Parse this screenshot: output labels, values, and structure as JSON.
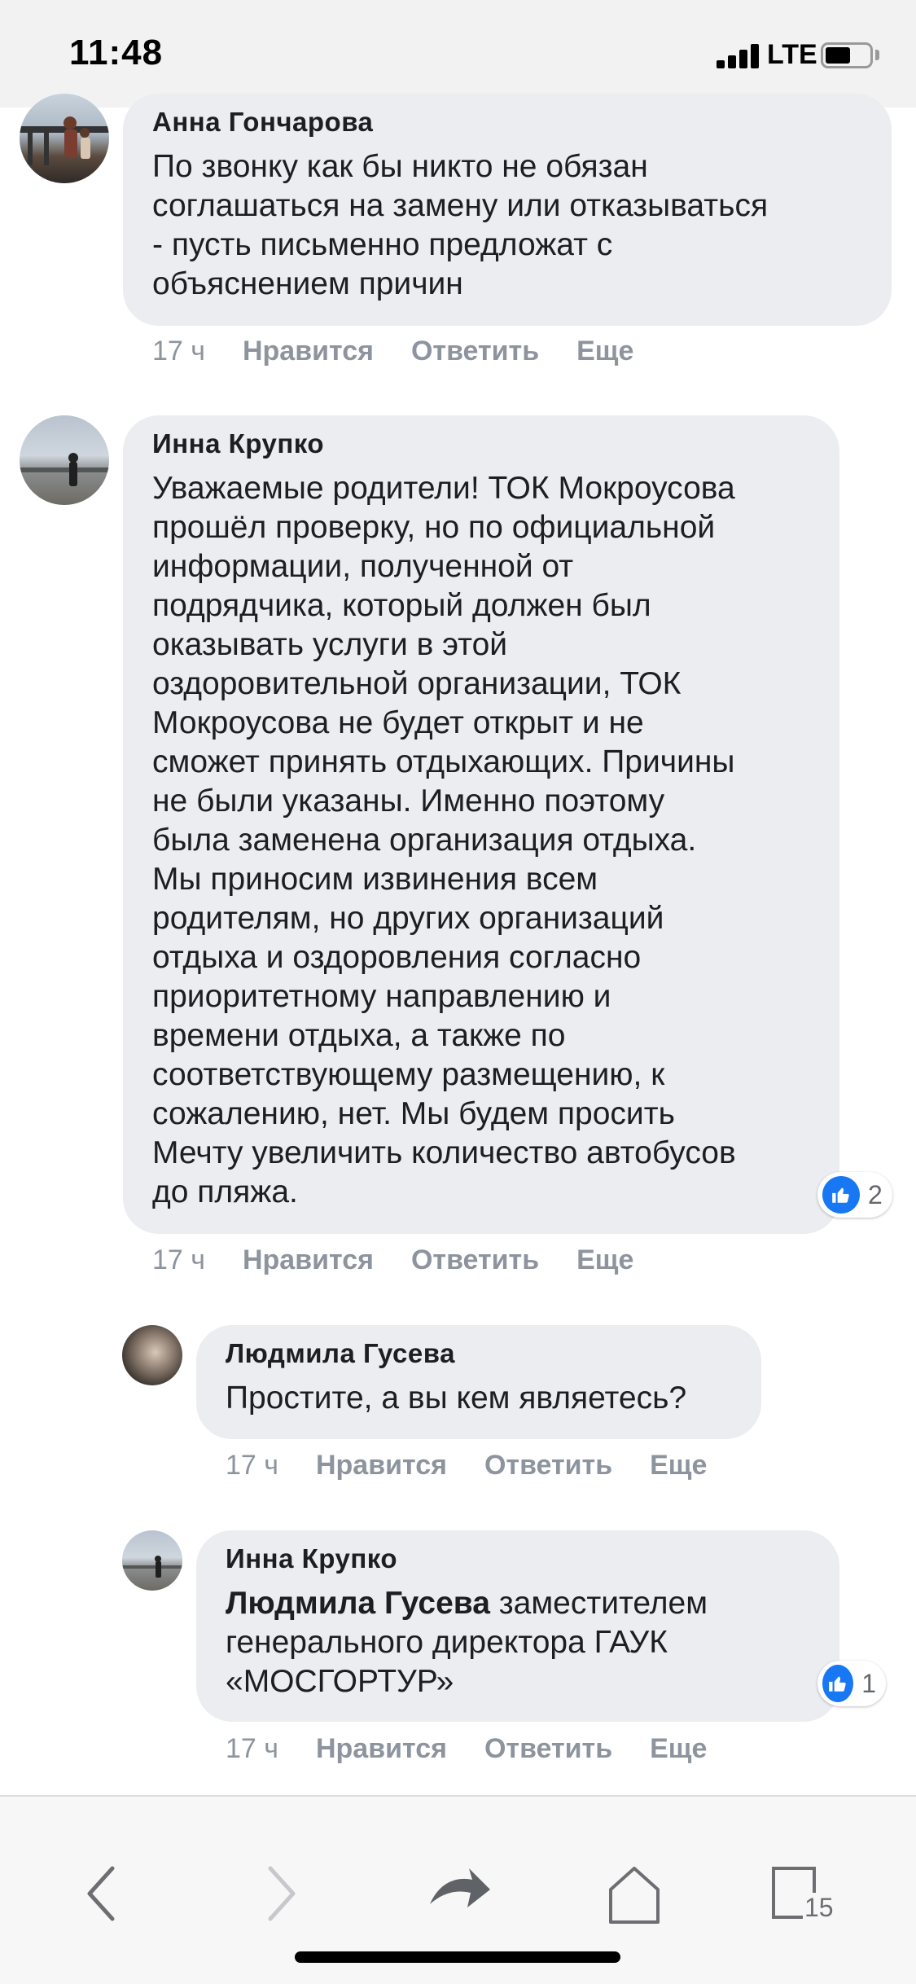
{
  "status_bar": {
    "time": "11:48",
    "network": "LTE"
  },
  "comments": [
    {
      "author": "Анна Гончарова",
      "text": "По звонку как бы никто не обязан\nсоглашаться на замену или отказываться\n- пусть письменно предложат с\nобъяснением причин",
      "time": "17 ч",
      "like": "Нравится",
      "reply": "Ответить",
      "more": "Еще"
    },
    {
      "author": "Инна Крупко",
      "text": "Уважаемые родители! ТОК Мокроусова\nпрошёл проверку, но по официальной\nинформации, полученной от\nподрядчика, который должен был\nоказывать услуги в этой\nоздоровительной организации, ТОК\nМокроусова не будет открыт и не\nсможет принять отдыхающих. Причины\nне были указаны. Именно поэтому\nбыла заменена организация отдыха.\nМы приносим извинения всем\nродителям, но других организаций\nотдыха и оздоровления согласно\nприоритетному направлению и\nвремени отдыха, а также по\nсоответствующему размещению, к\nсожалению, нет. Мы будем просить\nМечту увеличить количество автобусов\nдо пляжа.",
      "time": "17 ч",
      "like": "Нравится",
      "reply": "Ответить",
      "more": "Еще",
      "reaction_count": "2"
    },
    {
      "author": "Людмила Гусева",
      "text": "Простите, а вы кем являетесь?",
      "time": "17 ч",
      "like": "Нравится",
      "reply": "Ответить",
      "more": "Еще"
    },
    {
      "author": "Инна Крупко",
      "mention": "Людмила Гусева",
      "text_line1": " заместителем",
      "text_rest": "генерального директора ГАУК\n«МОСГОРТУР»",
      "time": "17 ч",
      "like": "Нравится",
      "reply": "Ответить",
      "more": "Еще",
      "reaction_count": "1"
    }
  ],
  "toolbar": {
    "tabs_count": "15"
  },
  "colors": {
    "bubble": "#ebedf0",
    "meta": "#8d949e",
    "like_blue": "#1877f2"
  }
}
